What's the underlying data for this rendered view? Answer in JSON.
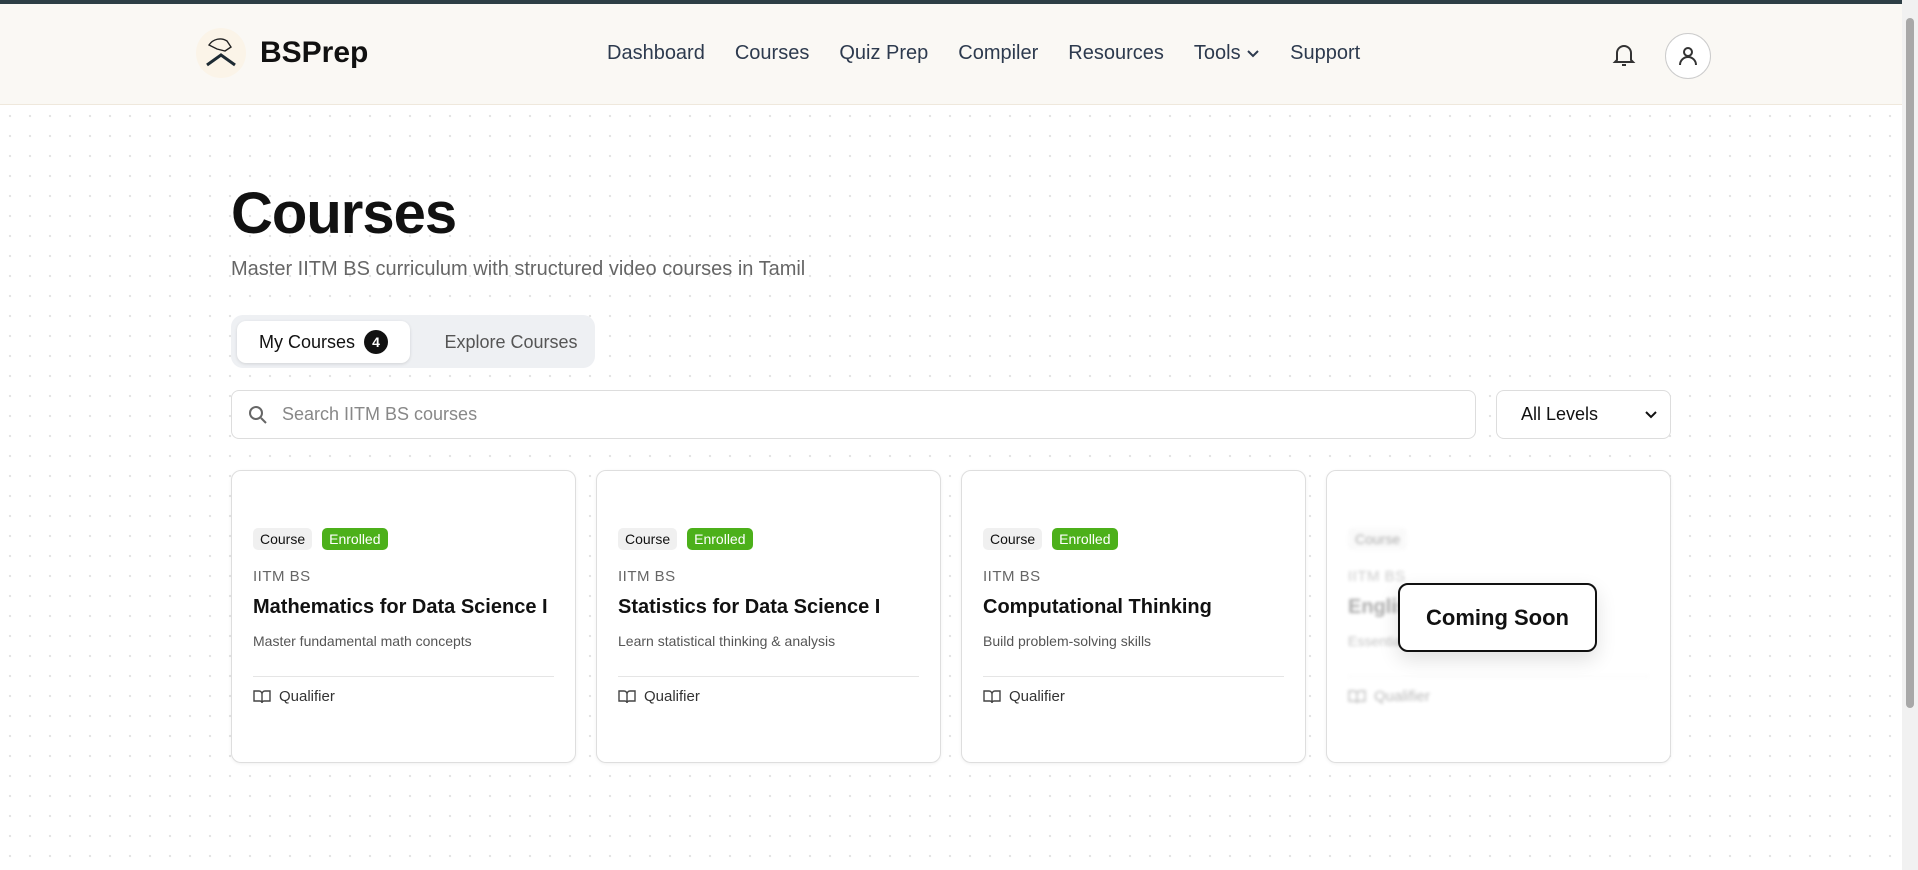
{
  "header": {
    "brand": "BSPrep",
    "nav": [
      "Dashboard",
      "Courses",
      "Quiz Prep",
      "Compiler",
      "Resources",
      "Tools",
      "Support"
    ]
  },
  "page": {
    "title": "Courses",
    "subtitle": "Master IITM BS curriculum with structured video courses in Tamil"
  },
  "tabs": {
    "my_courses": "My Courses",
    "my_count": "4",
    "explore": "Explore Courses"
  },
  "search": {
    "placeholder": "Search IITM BS courses"
  },
  "filter": {
    "selected": "All Levels"
  },
  "cards": [
    {
      "type": "Course",
      "status": "Enrolled",
      "org": "IITM BS",
      "title": "Mathematics for Data Science I",
      "desc": "Master fundamental math concepts",
      "level": "Qualifier"
    },
    {
      "type": "Course",
      "status": "Enrolled",
      "org": "IITM BS",
      "title": "Statistics for Data Science I",
      "desc": "Learn statistical thinking & analysis",
      "level": "Qualifier"
    },
    {
      "type": "Course",
      "status": "Enrolled",
      "org": "IITM BS",
      "title": "Computational Thinking",
      "desc": "Build problem-solving skills",
      "level": "Qualifier"
    },
    {
      "type": "Course",
      "org": "IITM BS",
      "title": "English I",
      "desc": "Essential English skills",
      "level": "Qualifier",
      "overlay": "Coming Soon"
    }
  ],
  "colors": {
    "enrolled": "#4cb01a",
    "topbar": "#2d3e45"
  }
}
